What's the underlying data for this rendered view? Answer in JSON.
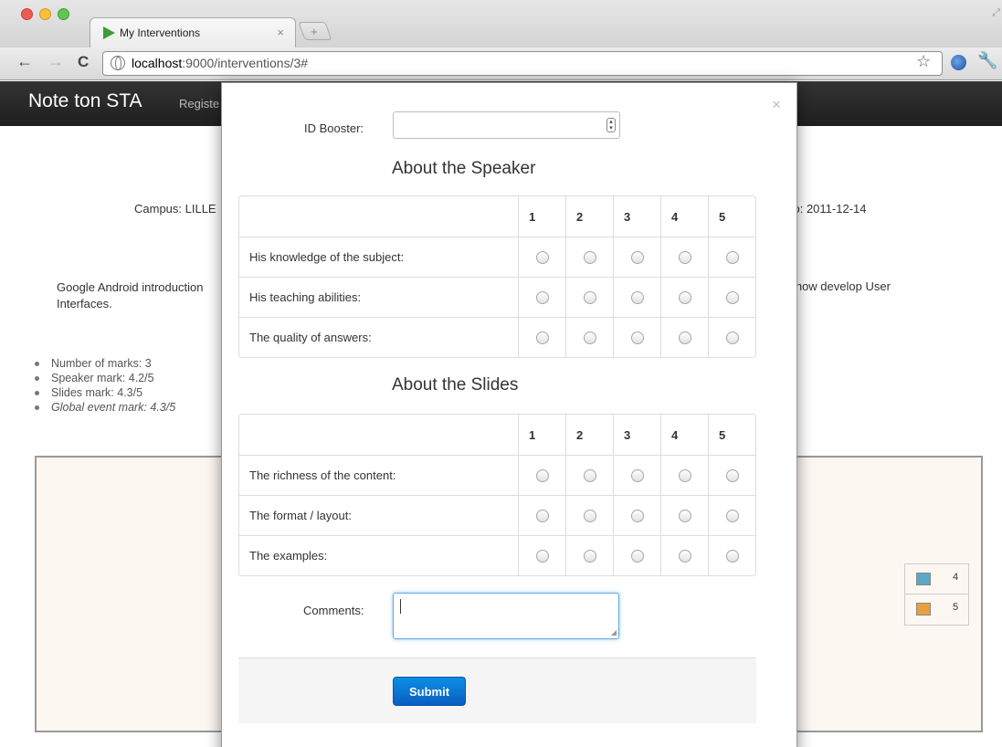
{
  "browser": {
    "tab_title": "My Interventions",
    "tab_close": "×",
    "new_tab": "+",
    "url_host": "localhost",
    "url_path": ":9000/interventions/3#"
  },
  "navbar": {
    "brand": "Note ton STA",
    "link_partial": "Registe"
  },
  "page": {
    "campus_partial": "Campus: LILLE",
    "to_date_partial": "To: 2011-12-14",
    "desc_left": "Google Android introduction",
    "desc_left_2": "Interfaces.",
    "desc_right": "d how develop User",
    "stats": [
      "Number of marks: 3",
      "Speaker mark: 4.2/5",
      "Slides mark: 4.3/5",
      "Global event mark: 4.3/5"
    ]
  },
  "chart_data": {
    "type": "pie",
    "legend": [
      {
        "label": "4",
        "color": "#5aa9c9"
      },
      {
        "label": "5",
        "color": "#e8a040"
      }
    ],
    "legend_placement": "right"
  },
  "modal": {
    "close": "×",
    "id_label": "ID Booster:",
    "speaker_title": "About the Speaker",
    "slides_title": "About the Slides",
    "scale": [
      "1",
      "2",
      "3",
      "4",
      "5"
    ],
    "speaker_questions": [
      "His knowledge of the subject:",
      "His teaching abilities:",
      "The quality of answers:"
    ],
    "slides_questions": [
      "The richness of the content:",
      "The format / layout:",
      "The examples:"
    ],
    "comments_label": "Comments:",
    "submit_label": "Submit"
  }
}
